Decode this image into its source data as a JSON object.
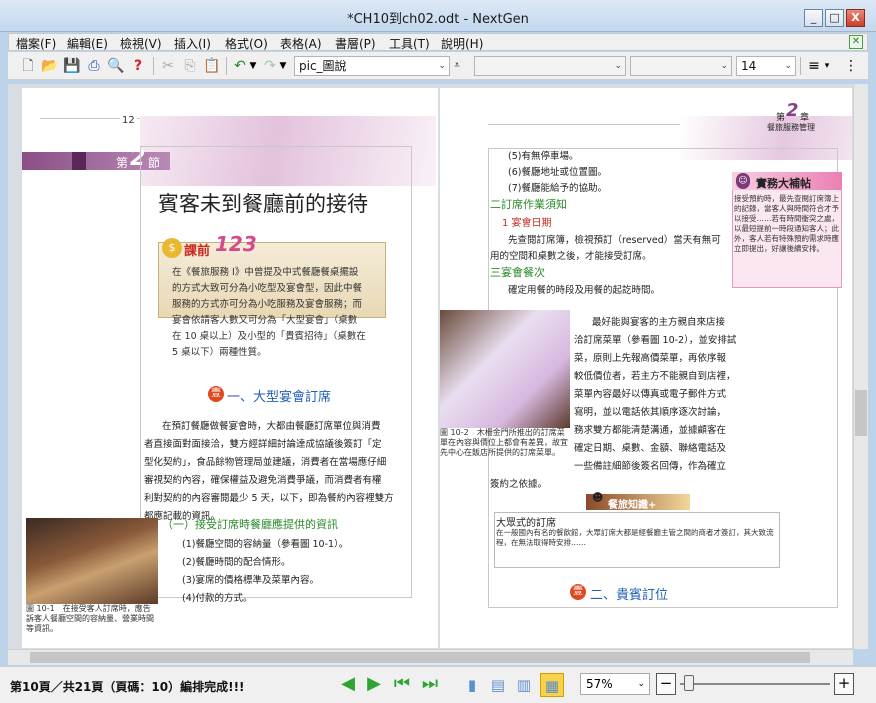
{
  "window": {
    "title": "*CH10到ch02.odt - NextGen",
    "minimize": "_",
    "maximize": "□",
    "close": "X"
  },
  "menu": [
    "檔案(F)",
    "編輯(E)",
    "檢視(V)",
    "插入(I)",
    "格式(O)",
    "表格(A)",
    "書層(P)",
    "工具(T)",
    "說明(H)"
  ],
  "toolbar": {
    "style_name": "pic_圖說",
    "font_size": "14",
    "font_name": ""
  },
  "left_page": {
    "ruler_label": "12",
    "section_prefix": "第",
    "section_number": "2",
    "section_suffix": "節",
    "heading": "賓客未到餐廳前的接待",
    "pre_class_label": "課前",
    "pre_class_digits": "123",
    "intro_lines": [
      "在《餐旅服務 I》中曾提及中式餐廳餐桌擺設",
      "的方式大致可分為小吃型及宴會型，因此中餐",
      "服務的方式亦可分為小吃服務及宴會服務；而",
      "宴會依請客人數又可分為「大型宴會」（桌數",
      "在 10 桌以上）及小型的「貴賓招待」（桌數在",
      "5 桌以下）兩種性質。"
    ],
    "sec1_num": "壹",
    "sec1_title": "一、大型宴會訂席",
    "body_lines": [
      "在預訂餐廳做餐宴會時，大都由餐廳訂席單位與消費",
      "者直接面對面接洽，雙方經詳細討論達成協議後簽訂「定",
      "型化契約」，食品餘物管理局並建議，消費者在當場應仔細",
      "審視契約內容，確保權益及避免消費爭議，而消費者有權",
      "利對契約的內容審閱最少 5 天，以下，即為餐約內容裡雙方",
      "都應記載的資訊。"
    ],
    "sub1_title": "（一）接受訂席時餐廳應提供的資訊",
    "list_items": [
      "(1)餐廳空間的容納量（參看圖 10-1）。",
      "(2)餐廳時間的配合情形。",
      "(3)宴席的價格標準及菜單內容。",
      "(4)付款的方式。"
    ],
    "fig_caption": "圖 10-1　在接受客人訂席時，應告訴客人餐廳空間的容納量、營業時間等資訊。"
  },
  "right_page": {
    "chapter_prefix": "第",
    "chapter_number": "2",
    "chapter_suffix": "章",
    "chapter_name": "餐旅服務管理",
    "top_items": [
      "(5)有無停車場。",
      "(6)餐廳地址或位置圖。",
      "(7)餐廳能給予的協助。"
    ],
    "sub2_title": "二訂席作業須知",
    "sub2_item": "1 宴會日期",
    "sub2_text": [
      "先查閱訂席簿，檢視預訂（reserved）當天有無可",
      "用的空間和桌數之後，才能接受訂席。"
    ],
    "sub3_title": "三宴會餐次",
    "sub3_text": "確定用餐的時段及用餐的起訖時間。",
    "right_body": [
      "最好能與宴客的主方親自來店接",
      "洽訂席菜單（參看圖 10-2），並安排試",
      "菜，原則上先報高價菜單，再依序報",
      "較低價位者，若主方不能親自到店裡，",
      "菜單內容最好以傳真或電子郵件方式",
      "寫明，並以電話依其順序逐次討論，",
      "務求雙方都能清楚溝通，並據顧客在",
      "確定日期、桌數、金額、聯絡電話及",
      "一些備註細節後簽名回傳，作為確立",
      "簽約之依據。"
    ],
    "fig_caption": "圖 10-2　木柵金門所推出的訂席菜單在內容與價位上都會有差異，故宜先中心在飯店所提供的訂席菜單。",
    "side_title": "實務大補帖",
    "side_text": "接受預約時，最先查閱訂席簿上的記錄，當客人與時間符合才予以接受……若有時間衝突之處，以最短提前一時段通知客人；此外，客人若有特殊預約需求時應立即提出，好讓後續安排。",
    "trivia_title": "餐旅知識+",
    "trivia_head": "大眾式的訂席",
    "trivia_text": "在一般國內有名的餐飲館，大眾訂席大都是經餐廳主管之間的商者才簽訂，其大致流程，在無法取得時安排……",
    "sec2_num": "壹",
    "sec2_title": "二、貴賓訂位"
  },
  "status": {
    "text": "第10頁／共21頁（頁碼：10）編排完成!!!",
    "zoom": "57%"
  },
  "colors": {
    "section_purple": "#7a3b78",
    "accent_blue": "#1f5fb4",
    "heading_green": "#2b8a2b",
    "red": "#c8281e",
    "nav_green": "#2ea52e",
    "active_yellow": "#f7d24a"
  }
}
